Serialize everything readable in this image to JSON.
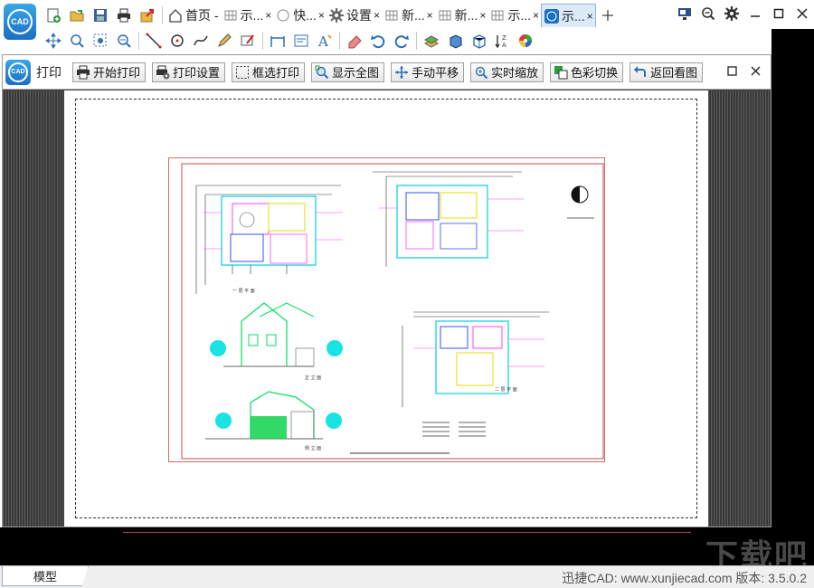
{
  "app": {
    "logo_text": "CAD"
  },
  "tabs": [
    {
      "label": "首页 -",
      "icon": "home-icon"
    },
    {
      "label": "示...",
      "icon": "grid-icon"
    },
    {
      "label": "快...",
      "icon": "circle-icon"
    },
    {
      "label": "设置",
      "icon": "gear-icon"
    },
    {
      "label": "新...",
      "icon": "grid-icon"
    },
    {
      "label": "新...",
      "icon": "grid-icon"
    },
    {
      "label": "示...",
      "icon": "grid-icon"
    },
    {
      "label": "示...",
      "icon": "cad-icon",
      "active": true
    }
  ],
  "tab_close_glyph": "×",
  "print_panel": {
    "title": "打印",
    "buttons": [
      {
        "label": "开始打印",
        "icon": "printer-icon"
      },
      {
        "label": "打印设置",
        "icon": "print-settings-icon"
      },
      {
        "label": "框选打印",
        "icon": "box-select-icon"
      },
      {
        "label": "显示全图",
        "icon": "zoom-extents-icon"
      },
      {
        "label": "手动平移",
        "icon": "pan-icon"
      },
      {
        "label": "实时缩放",
        "icon": "realtime-zoom-icon"
      },
      {
        "label": "色彩切换",
        "icon": "color-switch-icon"
      },
      {
        "label": "返回看图",
        "icon": "return-icon"
      }
    ]
  },
  "drawing": {
    "plan_label_1": "一 层 平 面",
    "plan_label_2": "二 层 平 面",
    "elevation_label_1": "正 立 面",
    "elevation_label_2": "侧 立 面"
  },
  "status": {
    "model_tab": "模型",
    "info": "迅捷CAD: www.xunjiecad.com 版本: 3.5.0.2"
  },
  "watermark": "下载吧",
  "colors": {
    "accent": "#1b6fc2",
    "sheet_border": "#d06a6a",
    "panel_bg": "#3c3c3c"
  }
}
